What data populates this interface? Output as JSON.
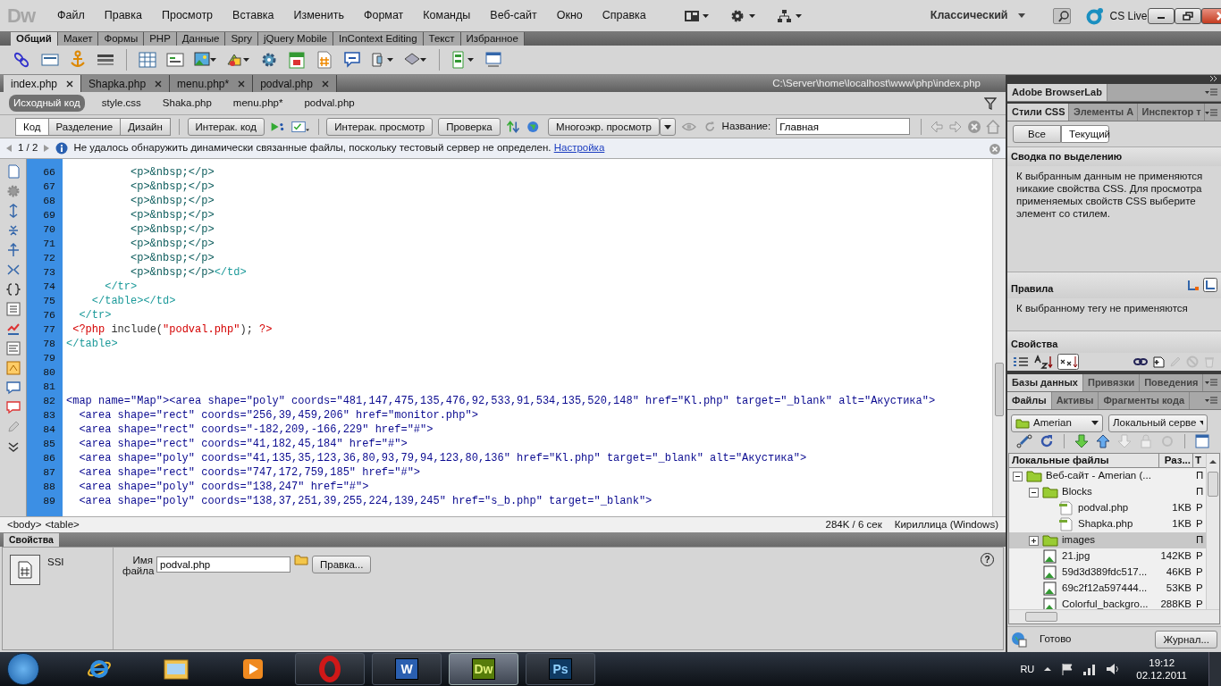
{
  "app": {
    "logo": "Dw",
    "menu": [
      "Файл",
      "Правка",
      "Просмотр",
      "Вставка",
      "Изменить",
      "Формат",
      "Команды",
      "Веб-сайт",
      "Окно",
      "Справка"
    ],
    "workspace": "Классический",
    "cs_live": "CS Live"
  },
  "insert_tabs": [
    {
      "label": "Общий",
      "selected": true
    },
    {
      "label": "Макет",
      "selected": false
    },
    {
      "label": "Формы",
      "selected": false
    },
    {
      "label": "PHP",
      "selected": false
    },
    {
      "label": "Данные",
      "selected": false
    },
    {
      "label": "Spry",
      "selected": false
    },
    {
      "label": "jQuery Mobile",
      "selected": false
    },
    {
      "label": "InContext Editing",
      "selected": false
    },
    {
      "label": "Текст",
      "selected": false
    },
    {
      "label": "Избранное",
      "selected": false
    }
  ],
  "doc_tabs": [
    {
      "label": "index.php",
      "selected": true
    },
    {
      "label": "Shapka.php",
      "selected": false
    },
    {
      "label": "menu.php*",
      "selected": false
    },
    {
      "label": "podval.php",
      "selected": false
    }
  ],
  "doc_path": "C:\\Server\\home\\localhost\\www\\php\\index.php",
  "related_files": [
    {
      "label": "Исходный код",
      "selected": true
    },
    {
      "label": "style.css",
      "selected": false
    },
    {
      "label": "Shaka.php",
      "selected": false
    },
    {
      "label": "menu.php*",
      "selected": false
    },
    {
      "label": "podval.php",
      "selected": false
    }
  ],
  "view_buttons": [
    {
      "label": "Код",
      "selected": true
    },
    {
      "label": "Разделение",
      "selected": false
    },
    {
      "label": "Дизайн",
      "selected": false
    }
  ],
  "toolbar_buttons": [
    "Интерак. код",
    "Интерак. просмотр",
    "Проверка",
    "Многоэкр. просмотр"
  ],
  "page_title": {
    "label": "Название:",
    "value": "Главная"
  },
  "info_bar": {
    "pager": "1 / 2",
    "message": "Не удалось обнаружить динамически связанные файлы, поскольку тестовый сервер не определен.",
    "link": "Настройка"
  },
  "code": {
    "lines": [
      {
        "number": "66",
        "segments": [
          {
            "kind": "p-tag",
            "text": "          <p>&nbsp;</p>"
          }
        ]
      },
      {
        "number": "67",
        "segments": [
          {
            "kind": "p-tag",
            "text": "          <p>&nbsp;</p>"
          }
        ]
      },
      {
        "number": "68",
        "segments": [
          {
            "kind": "p-tag",
            "text": "          <p>&nbsp;</p>"
          }
        ]
      },
      {
        "number": "69",
        "segments": [
          {
            "kind": "p-tag",
            "text": "          <p>&nbsp;</p>"
          }
        ]
      },
      {
        "number": "70",
        "segments": [
          {
            "kind": "p-tag",
            "text": "          <p>&nbsp;</p>"
          }
        ]
      },
      {
        "number": "71",
        "segments": [
          {
            "kind": "p-tag",
            "text": "          <p>&nbsp;</p>"
          }
        ]
      },
      {
        "number": "72",
        "segments": [
          {
            "kind": "p-tag",
            "text": "          <p>&nbsp;</p>"
          }
        ]
      },
      {
        "number": "73",
        "segments": [
          {
            "kind": "p-tag",
            "text": "          <p>&nbsp;</p>"
          },
          {
            "kind": "table-tag",
            "text": "</td>"
          }
        ]
      },
      {
        "number": "74",
        "segments": [
          {
            "kind": "table-tag",
            "text": "      </tr>"
          }
        ]
      },
      {
        "number": "75",
        "segments": [
          {
            "kind": "table-tag",
            "text": "    </table></td>"
          }
        ]
      },
      {
        "number": "76",
        "segments": [
          {
            "kind": "table-tag",
            "text": "  </tr>"
          }
        ]
      },
      {
        "number": "77",
        "segments": [
          {
            "kind": "php",
            "text": " <?php"
          },
          {
            "kind": "plain",
            "text": " include("
          },
          {
            "kind": "php",
            "text": "\"podval.php\""
          },
          {
            "kind": "plain",
            "text": "); "
          },
          {
            "kind": "php",
            "text": "?>"
          }
        ]
      },
      {
        "number": "78",
        "segments": [
          {
            "kind": "table-tag",
            "text": "</table>"
          }
        ]
      },
      {
        "number": "79"
      },
      {
        "number": "80"
      },
      {
        "number": "81"
      },
      {
        "number": "82",
        "segments": [
          {
            "kind": "map-tag",
            "text": "<map name=\"Map\"><area shape=\"poly\" coords=\"481,147,475,135,476,92,533,91,534,135,520,148\" href=\"Kl.php\" target=\"_blank\" alt=\"Акустика\">"
          }
        ]
      },
      {
        "number": "83",
        "segments": [
          {
            "kind": "map-tag",
            "text": "  <area shape=\"rect\" coords=\"256,39,459,206\" href=\"monitor.php\">"
          }
        ]
      },
      {
        "number": "84",
        "segments": [
          {
            "kind": "map-tag",
            "text": "  <area shape=\"rect\" coords=\"-182,209,-166,229\" href=\"#\">"
          }
        ]
      },
      {
        "number": "85",
        "segments": [
          {
            "kind": "map-tag",
            "text": "  <area shape=\"rect\" coords=\"41,182,45,184\" href=\"#\">"
          }
        ]
      },
      {
        "number": "86",
        "segments": [
          {
            "kind": "map-tag",
            "text": "  <area shape=\"poly\" coords=\"41,135,35,123,36,80,93,79,94,123,80,136\" href=\"Kl.php\" target=\"_blank\" alt=\"Акустика\">"
          }
        ]
      },
      {
        "number": "87",
        "segments": [
          {
            "kind": "map-tag",
            "text": "  <area shape=\"rect\" coords=\"747,172,759,185\" href=\"#\">"
          }
        ]
      },
      {
        "number": "88",
        "segments": [
          {
            "kind": "map-tag",
            "text": "  <area shape=\"poly\" coords=\"138,247\" href=\"#\">"
          }
        ]
      },
      {
        "number": "89",
        "segments": [
          {
            "kind": "map-tag",
            "text": "  <area shape=\"poly\" coords=\"138,37,251,39,255,224,139,245\" href=\"s_b.php\" target=\"_blank\">"
          }
        ]
      }
    ]
  },
  "status_bar": {
    "tags": [
      "<body>",
      "<table>"
    ],
    "size": "284K / 6 сек",
    "encoding": "Кириллица (Windows)"
  },
  "properties": {
    "title": "Свойства",
    "type": "SSI",
    "file_label": "Имя файла",
    "file_value": "podval.php",
    "edit_button": "Правка...",
    "help": "?"
  },
  "right_panel": {
    "browserlab_tab": "Adobe BrowserLab",
    "css_tabs": [
      {
        "label": "Стили CSS",
        "selected": true
      },
      {
        "label": "Элементы A",
        "selected": false
      },
      {
        "label": "Инспектор т",
        "selected": false
      }
    ],
    "css_mode": [
      {
        "label": "Все",
        "selected": false
      },
      {
        "label": "Текущий",
        "selected": true
      }
    ],
    "summary_title": "Сводка по выделению",
    "summary_text": "К выбранным данным не применяются никакие свойства CSS.  Для просмотра применяемых свойств CSS выберите элемент со стилем.",
    "rules_title": "Правила",
    "rules_text": "К выбранному тегу не применяются",
    "properties_title": "Свойства",
    "data_tabs": [
      {
        "label": "Базы данных",
        "selected": true
      },
      {
        "label": "Привязки",
        "selected": false
      },
      {
        "label": "Поведения",
        "selected": false
      }
    ],
    "files_tabs": [
      {
        "label": "Файлы",
        "selected": true
      },
      {
        "label": "Активы",
        "selected": false
      },
      {
        "label": "Фрагменты кода",
        "selected": false
      }
    ],
    "site_select": "Amerian",
    "server_select": "Локальный серве",
    "columns": [
      "Локальные файлы",
      "Раз...",
      "Т"
    ],
    "tree": [
      {
        "name": "Веб-сайт - Amerian (...",
        "kind": "site",
        "type": "П",
        "expanded": true,
        "selected": false,
        "children": [
          {
            "name": "Blocks",
            "kind": "folder",
            "type": "П",
            "expanded": true,
            "selected": false,
            "children": [
              {
                "name": "podval.php",
                "kind": "php",
                "size": "1KB",
                "type": "Р",
                "selected": false
              },
              {
                "name": "Shapka.php",
                "kind": "php",
                "size": "1KB",
                "type": "Р",
                "selected": false
              }
            ]
          },
          {
            "name": "images",
            "kind": "folder",
            "type": "П",
            "expanded": false,
            "selected": true
          },
          {
            "name": "21.jpg",
            "kind": "image",
            "size": "142KB",
            "type": "Р",
            "selected": false
          },
          {
            "name": "59d3d389fdc517...",
            "kind": "image",
            "size": "46KB",
            "type": "Р",
            "selected": false
          },
          {
            "name": "69c2f12a597444...",
            "kind": "image",
            "size": "53KB",
            "type": "Р",
            "selected": false
          },
          {
            "name": "Colorful_backgro...",
            "kind": "image",
            "size": "288KB",
            "type": "Р",
            "selected": false
          }
        ]
      }
    ],
    "status": "Готово",
    "log_button": "Журнал..."
  },
  "taskbar": {
    "apps": [
      {
        "kind": "ie",
        "running": false,
        "selected": false
      },
      {
        "kind": "explorer",
        "running": false,
        "selected": false
      },
      {
        "kind": "media",
        "running": false,
        "selected": false
      },
      {
        "kind": "opera",
        "running": true,
        "selected": false
      },
      {
        "kind": "word",
        "label": "W",
        "running": true,
        "selected": false
      },
      {
        "kind": "dw",
        "label": "Dw",
        "running": true,
        "selected": true
      },
      {
        "kind": "ps",
        "label": "Ps",
        "running": true,
        "selected": false
      }
    ],
    "language": "RU",
    "time": "19:12",
    "date": "02.12.2011"
  }
}
